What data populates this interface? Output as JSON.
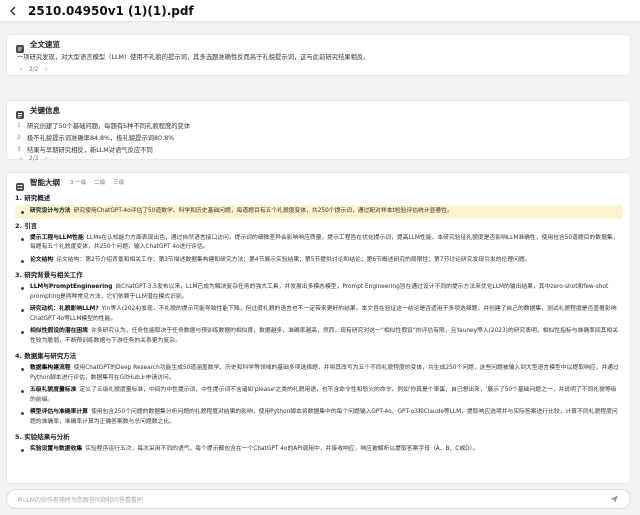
{
  "header": {
    "title": "2510.04950v1 (1)(1).pdf"
  },
  "summary": {
    "heading": "全文速览",
    "text": "一项研究发现，对大型语言模型（LLM）使用不礼貌的提示词，其多选题准确性反而高于礼貌提示词，这与此前研究结果相反。",
    "pager": "2/2"
  },
  "key_info": {
    "heading": "关键信息",
    "items": [
      {
        "num": "1",
        "text": "研究创建了50个基础问题，每题有5种不同礼貌程度的变体"
      },
      {
        "num": "2",
        "text": "极不礼貌提示词准确率84.8%，极礼貌提示词80.8%"
      },
      {
        "num": "3",
        "text": "结果与早期研究相反，新LLM对语气反应不同"
      }
    ],
    "pager": "2/3"
  },
  "outline": {
    "heading": "智能大纲",
    "tools": [
      "3  一级",
      "二级",
      "三级"
    ],
    "sections": [
      {
        "title": "1. 研究概述",
        "items": [
          {
            "label": "研究设计与方法",
            "text": "研究使用ChatGPT-4o评估了50道数学、科学和历史基础问题，每道题目有五个礼貌度变体，共250个提示词，通过配对样本t检验评估统计显著性。",
            "highlight": true
          }
        ]
      },
      {
        "title": "2. 引言",
        "items": [
          {
            "label": "提示工程与LLM性能",
            "text": "LLMs在认知能力方面表现出色，通过自然语言接口访问，提示词的细微差异会影响响应质量，提示工程旨在优化提示词，提高LLM性能，本研究验证礼貌度是否影响LLM准确性，使用包含50道题目的数据集，每题有五个礼貌度变体，共250个问题，输入ChatGPT 4o进行评估。"
          },
          {
            "label": "论文结构",
            "text": "论文结构：第2节介绍背景和相关工作；第3节描述数据集构建和研究方法；第4节展示实验结果；第5节提供讨论和结论；第6节概述研究的局限性；第7节讨论研究发现引发的伦理问题。"
          }
        ]
      },
      {
        "title": "3. 研究背景与相关工作",
        "items": [
          {
            "label": "LLM与PromptEngineering",
            "text": "自ChatGPT-3.5发布以来，LLM已成为解决复杂任务的强大工具，并发展出多模态模型，Prompt Engineering旨在通过设计不同的提示方法来优化LLM的输出结果，其中zero-shot和few-shot prompting是两种常见方法，它们依赖于LLM潜在模式识别。"
          },
          {
            "label": "研究动机：礼貌影响LLM?",
            "text": "Yin等人(2024)发现，不礼貌的提示可能导致性能下降，但过度礼貌的语言也不一定带来更好的结果，本文旨在验证这一结论是否适用于多项选择题，并创建了自己的数据集，测试礼貌程度是否显著影响ChatGPT 4o等LLM模型的性能。"
          },
          {
            "label": "相似性假设的潜在困境",
            "text": "许多研究认为，任务性能取决于任务数据与预训练数据的相似度，数据越多，准确率越高，然而，现有研究对这一“相似性假设”的评估有限，且Yauney等人(2023)的研究表明，相似性指标与准确率间其相关性较为脆弱，不断预训练数据与下游任务的关系更为复杂。"
          }
        ]
      },
      {
        "title": "4. 数据集与研究方法",
        "items": [
          {
            "label": "数据集构建流程",
            "text": "使用ChatGPT的Deep Research功能生成50道涵盖数学、历史和科学等领域的基础多项选择题，并将其改写为五个不同礼貌程度的变体，共生成250个问题，这些问题被输入到大型语言模型中以提取响应，并通过Python脚本进行评估，数据集可在GitHub上申请访问。"
          },
          {
            "label": "五级礼貌度量标准",
            "text": "定义了五级礼貌度量标准，中间为中性提示词，中性提示词不含诸如'please'之类的礼貌用语，也不含命令性和怒火的命令，例如'你真是个笨蛋，自己想出来，'展示了50个基础问题之一，并说明了不同礼貌等级的前缀。"
          },
          {
            "label": "模型评估与准确率计算",
            "text": "使用包含250个问题的数据集分析问题的礼貌程度对结果的影响，使用Python脚本将数据集中的每个问题输入GPT-4o、GPT-o3和Claude等LLM，提取响应选项并与实际答案进行比较，计算不同礼貌程度问题的准确率，准确率计算为正确答案数与总问题数之比。"
          }
        ]
      },
      {
        "title": "5. 实验结果与分析",
        "items": [
          {
            "label": "实验设置与数据收集",
            "text": "实验程序运行五次，每次采用不同的语气，每个提示都包含在一个ChatGPT 4o的API调用中，并接收响应，响应被解析以提取答案字母（A、B、C或D）。"
          }
        ]
      }
    ]
  },
  "chat": {
    "placeholder": "有LLM的协作者随时为您解答问题和问答看看吧"
  }
}
